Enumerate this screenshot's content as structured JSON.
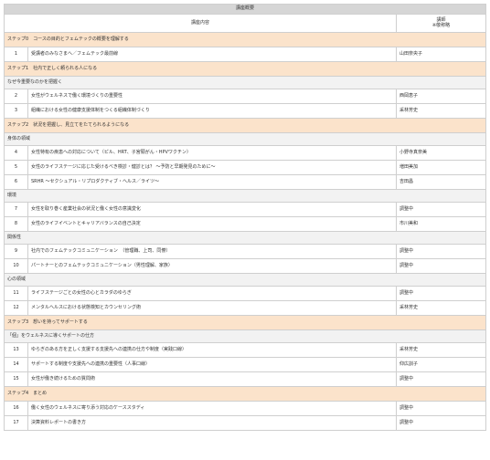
{
  "table": {
    "title": "講座概要",
    "col_content": "講座内容",
    "col_lecturer_line1": "講師",
    "col_lecturer_line2": "※敬称略",
    "rows": [
      {
        "kind": "step",
        "text": "ステップ0　コースの目的とフェムテックの概要を理解する"
      },
      {
        "kind": "row",
        "num": "1",
        "content": "受講者のみなさまへ／フェムテック最前線",
        "lecturer": "山田奈央子"
      },
      {
        "kind": "step",
        "text": "ステップ1　社内で正しく頼られる人になる"
      },
      {
        "kind": "sec",
        "text": "なぜ今重要なのかを把握く"
      },
      {
        "kind": "row",
        "num": "2",
        "content": "女性がウェルネスで働く環境づくりの重要性",
        "lecturer": "西岡恵子"
      },
      {
        "kind": "row",
        "num": "3",
        "content": "組織における女性の健康支援体制をつくる組織体制づくり",
        "lecturer": "采林芳史"
      },
      {
        "kind": "step",
        "text": "ステップ2　状況を把握し、見立てをたてられるようになる"
      },
      {
        "kind": "sec",
        "text": "身体の領域"
      },
      {
        "kind": "row",
        "num": "4",
        "content": "女性特有の疾患への対応について（ピル、HRT、子宮頸がん・HPVワクチン）",
        "lecturer": "小野寺真奈美"
      },
      {
        "kind": "row",
        "num": "5",
        "content": "女性のライフステージに応じた受けるべき検診・健診とは？ ～予防と早期発見のために～",
        "lecturer": "増田美加"
      },
      {
        "kind": "row",
        "num": "6",
        "content": "SRHR ～セクシュアル・リプロダクティブ・ヘルス／ライツ～",
        "lecturer": "吉田昌"
      },
      {
        "kind": "sec",
        "text": "環境"
      },
      {
        "kind": "row",
        "num": "7",
        "content": "女性を取り巻く産業社会の状況と働く女性の意識変化",
        "lecturer": "調整中"
      },
      {
        "kind": "row",
        "num": "8",
        "content": "女性のライフイベントとキャリアバランスの自己決定",
        "lecturer": "市川美和"
      },
      {
        "kind": "sec",
        "text": "関係性"
      },
      {
        "kind": "row",
        "num": "9",
        "content": "社内でのフェムテックコミュニケーション　（管理職、上司、同僚）",
        "lecturer": "調整中"
      },
      {
        "kind": "row",
        "num": "10",
        "content": "パートナーとのフェムテックコミュニケーション（男性理解、家族）",
        "lecturer": "調整中"
      },
      {
        "kind": "sec",
        "text": "心の領域"
      },
      {
        "kind": "row",
        "num": "11",
        "content": "ライフステージごとの女性の心とカラダのゆらぎ",
        "lecturer": "調整中"
      },
      {
        "kind": "row",
        "num": "12",
        "content": "メンタルヘルスにおける状態検知とカウンセリング術",
        "lecturer": "采林芳史"
      },
      {
        "kind": "step",
        "text": "ステップ3　想いを持ってサポートする"
      },
      {
        "kind": "sec",
        "text": "「個」をウェルネスに導くサポートの仕方"
      },
      {
        "kind": "row",
        "num": "13",
        "content": "ゆらぎのある方を正しく支援する支援先への連携の仕方や制度（実践口線）",
        "lecturer": "采林芳史"
      },
      {
        "kind": "row",
        "num": "14",
        "content": "サポートする制度や支援先への連携の重要性（人事口線）",
        "lecturer": "仰広訓子"
      },
      {
        "kind": "row",
        "num": "15",
        "content": "女性が働き続けるための質問術",
        "lecturer": "調整中"
      },
      {
        "kind": "step",
        "text": "ステップ4　まとめ"
      },
      {
        "kind": "row",
        "num": "16",
        "content": "働く女性のウェルネスに寄り添う対応のケーススタディ",
        "lecturer": "調整中"
      },
      {
        "kind": "row",
        "num": "17",
        "content": "決算資料レポートの書き方",
        "lecturer": "調整中"
      }
    ]
  }
}
